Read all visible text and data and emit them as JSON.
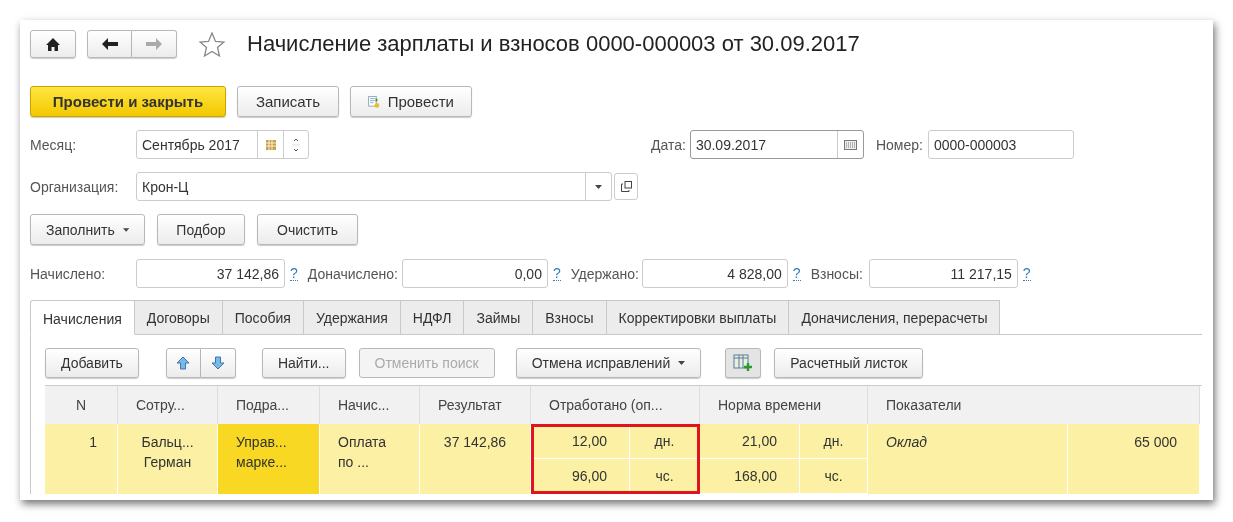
{
  "header": {
    "title": "Начисление зарплаты и взносов 0000-000003 от 30.09.2017",
    "favorite": false
  },
  "commands": [
    {
      "label": "Провести и закрыть",
      "kind": "primary"
    },
    {
      "label": "Записать",
      "kind": "plain"
    },
    {
      "label": "Провести",
      "kind": "post"
    }
  ],
  "month": {
    "label": "Месяц:",
    "value": "Сентябрь 2017"
  },
  "date": {
    "label": "Дата:",
    "value": "30.09.2017"
  },
  "number": {
    "label": "Номер:",
    "value": "0000-000003"
  },
  "organization": {
    "label": "Организация:",
    "value": "Крон-Ц"
  },
  "fill_buttons": [
    {
      "label": "Заполнить",
      "dropdown": true
    },
    {
      "label": "Подбор",
      "dropdown": false
    },
    {
      "label": "Очистить",
      "dropdown": false
    }
  ],
  "totals": [
    {
      "label": "Начислено:",
      "value": "37 142,86",
      "help": "?"
    },
    {
      "label": "Доначислено:",
      "value": "0,00",
      "help": "?"
    },
    {
      "label": "Удержано:",
      "value": "4 828,00",
      "help": "?"
    },
    {
      "label": "Взносы:",
      "value": "11 217,15",
      "help": "?"
    }
  ],
  "tabs": [
    {
      "label": "Начисления",
      "selected": true
    },
    {
      "label": "Договоры",
      "selected": false
    },
    {
      "label": "Пособия",
      "selected": false
    },
    {
      "label": "Удержания",
      "selected": false
    },
    {
      "label": "НДФЛ",
      "selected": false
    },
    {
      "label": "Займы",
      "selected": false
    },
    {
      "label": "Взносы",
      "selected": false
    },
    {
      "label": "Корректировки выплаты",
      "selected": false
    },
    {
      "label": "Доначисления, перерасчеты",
      "selected": false
    }
  ],
  "table_toolbar": [
    {
      "kind": "text",
      "label": "Добавить",
      "disabled": false
    },
    {
      "kind": "arrows"
    },
    {
      "kind": "text",
      "label": "Найти...",
      "disabled": false
    },
    {
      "kind": "text",
      "label": "Отменить поиск",
      "disabled": true
    },
    {
      "kind": "dropdown",
      "label": "Отмена исправлений",
      "disabled": false
    },
    {
      "kind": "icon"
    },
    {
      "kind": "text",
      "label": "Расчетный листок",
      "disabled": false
    }
  ],
  "table": {
    "columns": [
      "N",
      "Сотру...",
      "Подра...",
      "Начис...",
      "Результат",
      "Отработано (оп...",
      "Норма времени",
      "Показатели"
    ],
    "rows": [
      {
        "selected": true,
        "n": "1",
        "employee": "Бальц...\nГерман",
        "department": "Управ...\nмарке...",
        "department_focused": true,
        "accrual": "Оплата\nпо ...",
        "result": "37 142,86",
        "worked_highlighted": true,
        "worked": [
          {
            "value": "12,00",
            "unit": "дн."
          },
          {
            "value": "96,00",
            "unit": "чс."
          }
        ],
        "norm": [
          {
            "value": "21,00",
            "unit": "дн."
          },
          {
            "value": "168,00",
            "unit": "чс."
          }
        ],
        "indicator": "Оклад",
        "indicator_value": "65 000"
      }
    ]
  }
}
